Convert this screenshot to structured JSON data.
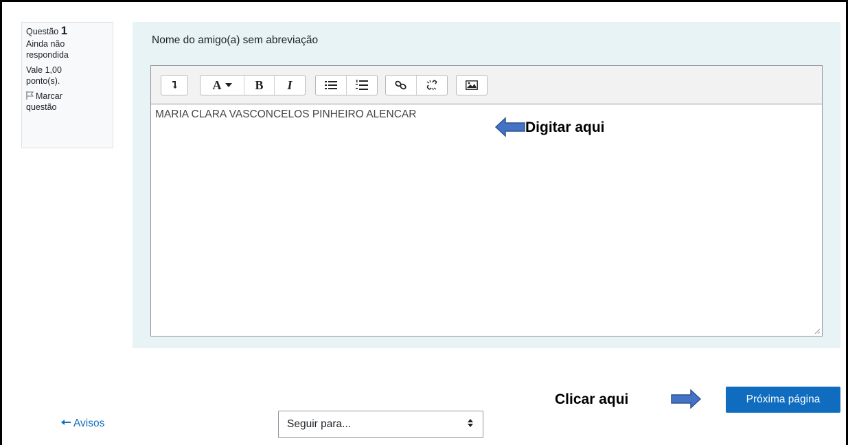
{
  "info": {
    "question_label": "Questão",
    "question_number": "1",
    "state_line1": "Ainda não",
    "state_line2": "respondida",
    "grade_line1": "Vale 1,00",
    "grade_line2": "ponto(s).",
    "flag_line1": "Marcar",
    "flag_line2": "questão"
  },
  "question": {
    "text": "Nome do amigo(a) sem abreviação",
    "answer_value": "MARIA CLARA VASCONCELOS PINHEIRO ALENCAR"
  },
  "toolbar": {
    "icons": [
      "toggle-toolbar-icon",
      "font-color-icon",
      "bold-icon",
      "italic-icon",
      "unordered-list-icon",
      "ordered-list-icon",
      "link-icon",
      "unlink-icon",
      "image-icon"
    ],
    "font_color_label": "A",
    "bold_label": "B",
    "italic_label": "I"
  },
  "annotations": {
    "type_here": "Digitar aqui",
    "click_here": "Clicar aqui",
    "arrow_color": "#4472c4"
  },
  "navigation": {
    "next_button": "Próxima página",
    "prev_link": "Avisos",
    "jump_select": "Seguir para..."
  },
  "colors": {
    "primary": "#0f6cbf",
    "formulation_bg": "#e7f3f5"
  }
}
